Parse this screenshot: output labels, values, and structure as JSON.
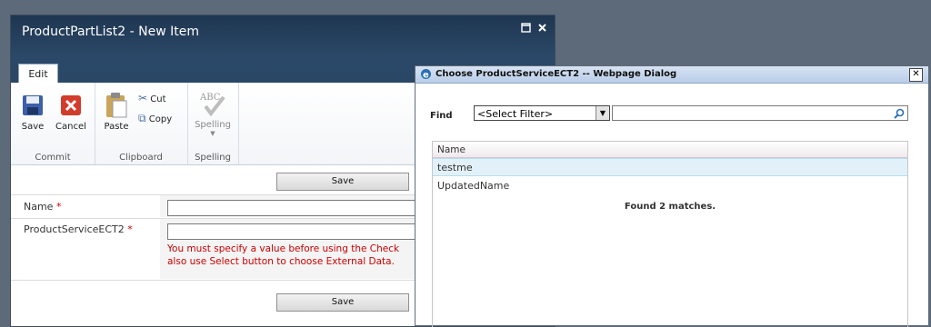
{
  "window": {
    "title": "ProductPartList2 - New Item"
  },
  "ribbon": {
    "tab": "Edit",
    "groups": [
      {
        "name": "Commit",
        "buttons": [
          "Save",
          "Cancel"
        ]
      },
      {
        "name": "Clipboard",
        "buttons": [
          "Paste"
        ],
        "small": [
          "Cut",
          "Copy"
        ]
      },
      {
        "name": "Spelling",
        "buttons": [
          "Spelling"
        ]
      }
    ]
  },
  "form": {
    "save_label": "Save",
    "fields": [
      {
        "label": "Name",
        "required": "*"
      },
      {
        "label": "ProductServiceECT2",
        "required": "*"
      }
    ],
    "error_line1": "You must specify a value before using the Check",
    "error_line2": "also use Select button to choose External Data."
  },
  "dialog": {
    "title": "Choose ProductServiceECT2 -- Webpage Dialog",
    "close": "✕",
    "find_label": "Find",
    "filter_value": "<Select Filter>",
    "column": "Name",
    "rows": [
      "testme",
      "UpdatedName"
    ],
    "status": "Found 2 matches."
  },
  "colors": {
    "titlebar": "#2b4868",
    "accent": "#2a6fb5",
    "error": "#cc0000",
    "selected_row": "#e2f1f9"
  }
}
